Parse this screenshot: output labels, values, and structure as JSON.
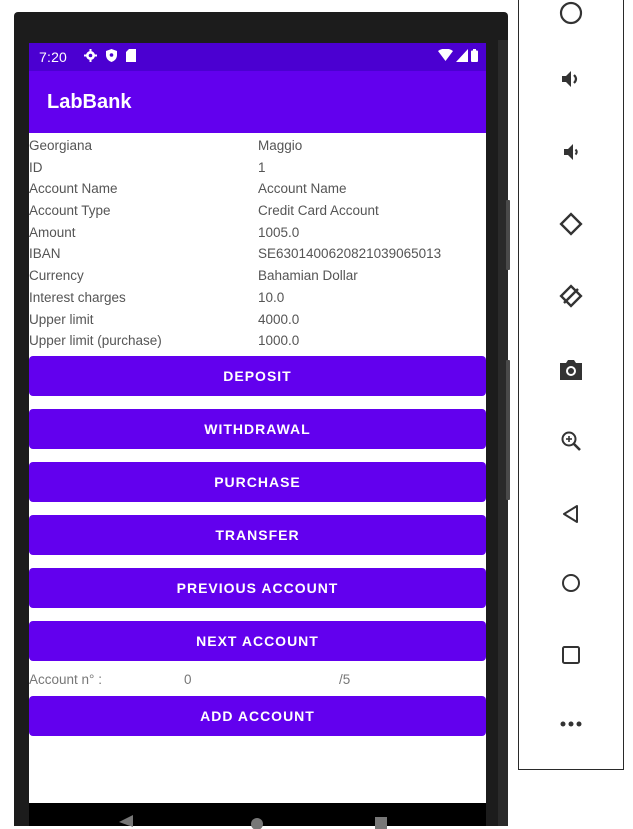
{
  "status_bar": {
    "time": "7:20"
  },
  "app_bar": {
    "title": "LabBank"
  },
  "account": {
    "rows": [
      {
        "label": "Georgiana",
        "value": "Maggio"
      },
      {
        "label": "ID",
        "value": "1"
      },
      {
        "label": "Account Name",
        "value": "Account Name"
      },
      {
        "label": "Account Type",
        "value": "Credit Card Account"
      },
      {
        "label": "Amount",
        "value": "1005.0"
      },
      {
        "label": "IBAN",
        "value": "SE6301400620821039065013"
      },
      {
        "label": "Currency",
        "value": "Bahamian Dollar"
      },
      {
        "label": "Interest charges",
        "value": "10.0"
      },
      {
        "label": "Upper limit",
        "value": "4000.0"
      },
      {
        "label": "Upper limit (purchase)",
        "value": "1000.0"
      }
    ]
  },
  "buttons": {
    "deposit": "DEPOSIT",
    "withdrawal": "WITHDRAWAL",
    "purchase": "PURCHASE",
    "transfer": "TRANSFER",
    "previous_account": "PREVIOUS ACCOUNT",
    "next_account": "NEXT ACCOUNT",
    "add_account": "ADD ACCOUNT"
  },
  "account_counter": {
    "label": "Account n° :",
    "current": "0",
    "total": "/5"
  },
  "colors": {
    "primary": "#6200ee",
    "primary_dark": "#4b00d1"
  },
  "emulator_toolbar": {
    "icons": [
      "power-icon",
      "volume-up-icon",
      "volume-down-icon",
      "rotate-left-icon",
      "rotate-right-icon",
      "camera-icon",
      "zoom-icon",
      "back-icon",
      "home-icon",
      "overview-icon",
      "more-icon"
    ]
  }
}
